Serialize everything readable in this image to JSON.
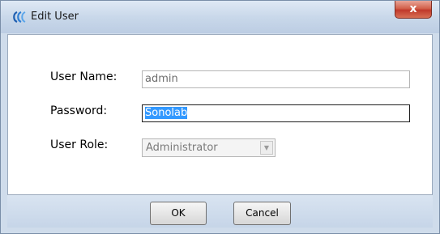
{
  "window": {
    "title": "Edit User",
    "close_glyph": "x",
    "app_icon": "wave-logo-icon"
  },
  "form": {
    "username": {
      "label": "User Name:",
      "value": "admin"
    },
    "password": {
      "label": "Password:",
      "value": "Sonolab"
    },
    "role": {
      "label": "User Role:",
      "value": "Administrator"
    }
  },
  "buttons": {
    "ok": "OK",
    "cancel": "Cancel"
  },
  "colors": {
    "selection": "#3399ff",
    "close_button": "#c0392b",
    "frame": "#cfdceb"
  }
}
